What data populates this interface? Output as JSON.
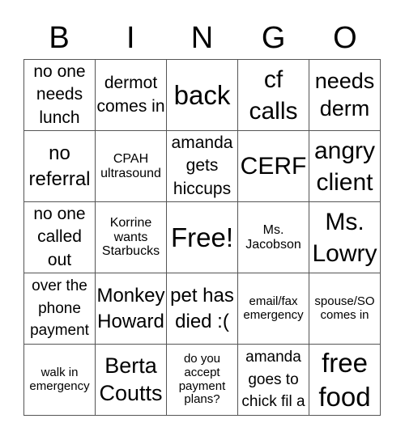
{
  "header": [
    "B",
    "I",
    "N",
    "G",
    "O"
  ],
  "cells": [
    [
      "no one needs lunch",
      "dermot comes in",
      "back",
      "cf calls",
      "needs derm"
    ],
    [
      "no referral",
      "CPAH ultrasound",
      "amanda gets hiccups",
      "CERF",
      "angry client"
    ],
    [
      "no one called out",
      "Korrine wants Starbucks",
      "Free!",
      "Ms. Jacobson",
      "Ms. Lowry"
    ],
    [
      "over the phone payment",
      "Monkey Howard",
      "pet has died :(",
      "email/fax emergency",
      "spouse/SO comes in"
    ],
    [
      "walk in emergency",
      "Berta Coutts",
      "do you accept payment plans?",
      "amanda goes to chick fil a",
      "free food"
    ]
  ]
}
